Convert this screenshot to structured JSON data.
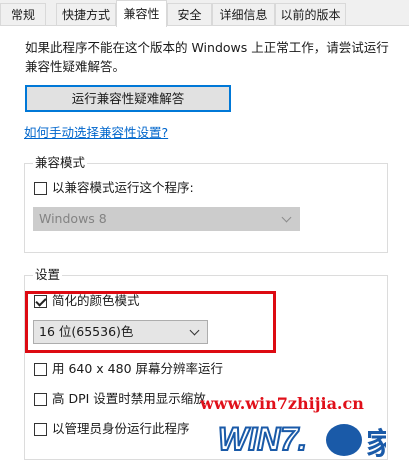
{
  "tabs": [
    {
      "label": "常规",
      "active": false
    },
    {
      "label": "快捷方式",
      "active": false
    },
    {
      "label": "兼容性",
      "active": true
    },
    {
      "label": "安全",
      "active": false
    },
    {
      "label": "详细信息",
      "active": false
    },
    {
      "label": "以前的版本",
      "active": false
    }
  ],
  "description": "如果此程序不能在这个版本的 Windows 上正常工作，请尝试运行兼容性疑难解答。",
  "troubleshooter_button": "运行兼容性疑难解答",
  "manual_link": "如何手动选择兼容性设置?",
  "compat_mode": {
    "title": "兼容模式",
    "checkbox_label": "以兼容模式运行这个程序:",
    "checked": false,
    "os_select": "Windows 8",
    "select_disabled": true
  },
  "settings": {
    "title": "设置",
    "reduced_color": {
      "label": "简化的颜色模式",
      "checked": true
    },
    "color_select": "16 位(65536)色",
    "options": [
      {
        "label": "用 640 x 480 屏幕分辨率运行",
        "checked": false
      },
      {
        "label": "高 DPI 设置时禁用显示缩放",
        "checked": false
      },
      {
        "label": "以管理员身份运行此程序",
        "checked": false
      }
    ]
  },
  "watermark": {
    "url": "www.win7zhijia.cn",
    "logo_text_left": "WIN7.",
    "logo_text_right": "家",
    "color": "#e0101a",
    "logo_color": "#1a5aa8"
  },
  "colors": {
    "accent": "#0078d7",
    "link": "#0066cc",
    "highlight": "#dd0a12"
  }
}
